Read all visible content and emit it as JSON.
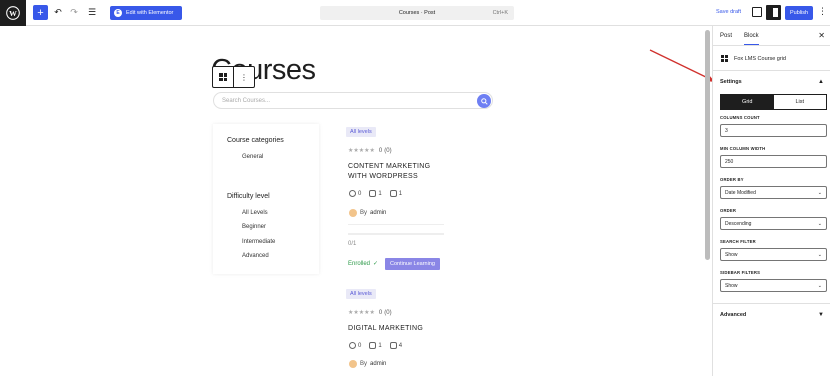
{
  "topbar": {
    "elementor_label": "Edit with Elementor",
    "doc_title": "Courses · Post",
    "shortcut": "Ctrl+K",
    "save_draft": "Save draft",
    "publish": "Publish"
  },
  "page": {
    "title": "Courses",
    "search_placeholder": "Search Courses..."
  },
  "filters": {
    "categories_heading": "Course categories",
    "categories": [
      "General"
    ],
    "difficulty_heading": "Difficulty level",
    "levels": [
      "All Levels",
      "Beginner",
      "Intermediate",
      "Advanced"
    ]
  },
  "courses": [
    {
      "level": "All levels",
      "rating": "0",
      "reviews": "(0)",
      "title_line1": "CONTENT MARKETING",
      "title_line2": "WITH WORDPRESS",
      "students": "0",
      "lessons": "1",
      "quizzes": "1",
      "author_prefix": "By",
      "author": "admin",
      "progress": "0/1",
      "progress_fraction": 0,
      "enrolled": "Enrolled",
      "continue": "Continue Learning"
    },
    {
      "level": "All levels",
      "rating": "0",
      "reviews": "(0)",
      "title_line1": "DIGITAL MARKETING",
      "students": "0",
      "lessons": "1",
      "quizzes": "4",
      "author_prefix": "By",
      "author": "admin"
    }
  ],
  "panel": {
    "tabs": [
      "Post",
      "Block"
    ],
    "active_tab": "Block",
    "block_name": "Fox LMS Course grid",
    "settings_title": "Settings",
    "layout_options": [
      "Grid",
      "List"
    ],
    "layout_selected": "Grid",
    "fields": {
      "columns_count": {
        "label": "COLUMNS COUNT",
        "value": "3"
      },
      "min_column_width": {
        "label": "MIN COLUMN WIDTH",
        "value": "250"
      },
      "order_by": {
        "label": "ORDER BY",
        "value": "Date Modified"
      },
      "order": {
        "label": "ORDER",
        "value": "Descending"
      },
      "search_filter": {
        "label": "SEARCH FILTER",
        "value": "Show"
      },
      "sidebar_filters": {
        "label": "SIDEBAR FILTERS",
        "value": "Show"
      }
    },
    "advanced_title": "Advanced"
  },
  "colors": {
    "accent": "#3858e9",
    "badge_text": "#5a5ad6",
    "continue_button": "#8a86e6",
    "enrolled": "#2e9a4a",
    "annotation_arrow": "#d0312d"
  }
}
